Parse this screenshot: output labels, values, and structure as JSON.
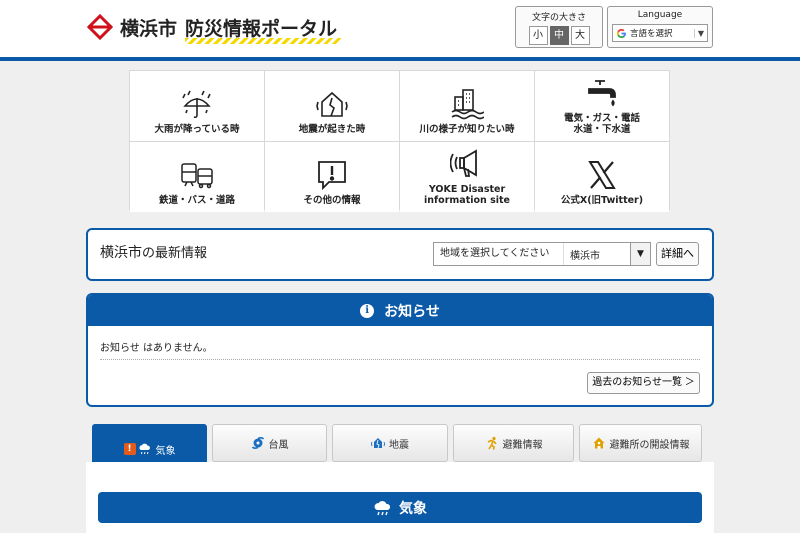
{
  "header": {
    "city": "横浜市",
    "portal": "防災情報ポータル",
    "font_size": {
      "label": "文字の大きさ",
      "options": [
        "小",
        "中",
        "大"
      ],
      "selected": "中"
    },
    "language": {
      "label": "Language",
      "select_text": "言語を選択"
    }
  },
  "categories": [
    {
      "label": "大雨が降っている時",
      "icon": "umbrella-rain-icon"
    },
    {
      "label": "地震が起きた時",
      "icon": "house-earthquake-icon"
    },
    {
      "label": "川の様子が知りたい時",
      "icon": "river-building-icon"
    },
    {
      "label": "電気・ガス・電話\n水道・下水道",
      "icon": "faucet-icon"
    },
    {
      "label": "鉄道・バス・道路",
      "icon": "train-bus-icon"
    },
    {
      "label": "その他の情報",
      "icon": "speech-exclamation-icon"
    },
    {
      "label": "YOKE Disaster\ninformation site",
      "icon": "megaphone-icon"
    },
    {
      "label": "公式X(旧Twitter)",
      "icon": "x-logo-icon"
    }
  ],
  "latest": {
    "city": "横浜市",
    "suffix": "の最新情報",
    "region_placeholder": "地域を選択してください",
    "region_value": "横浜市",
    "detail_button": "詳細へ"
  },
  "notice": {
    "title": "お知らせ",
    "message": "お知らせ はありません。",
    "past_button": "過去のお知らせ一覧 ＞"
  },
  "tabs": [
    {
      "label": "気象",
      "active": true
    },
    {
      "label": "台風",
      "active": false
    },
    {
      "label": "地震",
      "active": false
    },
    {
      "label": "避難情報",
      "active": false
    },
    {
      "label": "避難所の開設情報",
      "active": false
    }
  ],
  "weather": {
    "title": "気象"
  },
  "colors": {
    "primary": "#0b5aa8",
    "warning": "#e25b1c",
    "logo_red": "#d0111b",
    "accent_yellow": "#f3d900"
  }
}
